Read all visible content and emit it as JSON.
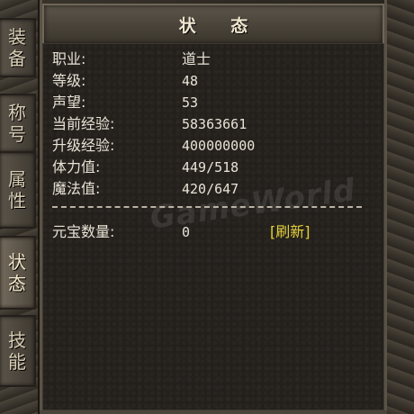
{
  "window": {
    "title": "状 态"
  },
  "tabs": [
    {
      "id": "equip",
      "label": "装备"
    },
    {
      "id": "title",
      "label": "称号"
    },
    {
      "id": "attr",
      "label": "属性"
    },
    {
      "id": "status",
      "label": "状态"
    },
    {
      "id": "skill",
      "label": "技能"
    }
  ],
  "stats": [
    {
      "label": "职业:",
      "value": "道士"
    },
    {
      "label": "等级:",
      "value": "48"
    },
    {
      "label": "声望:",
      "value": "53"
    },
    {
      "label": "当前经验:",
      "value": "58363661"
    },
    {
      "label": "升级经验:",
      "value": "400000000"
    },
    {
      "label": "体力值:",
      "value": "449/518"
    },
    {
      "label": "魔法值:",
      "value": "420/647"
    }
  ],
  "currency": {
    "label": "元宝数量:",
    "value": "0",
    "refresh_label": "[刷新]"
  },
  "watermark": "GameWorld",
  "colors": {
    "text": "#e9e3d6",
    "refresh": "#e6d23a",
    "panel_bg": "#23201c"
  }
}
